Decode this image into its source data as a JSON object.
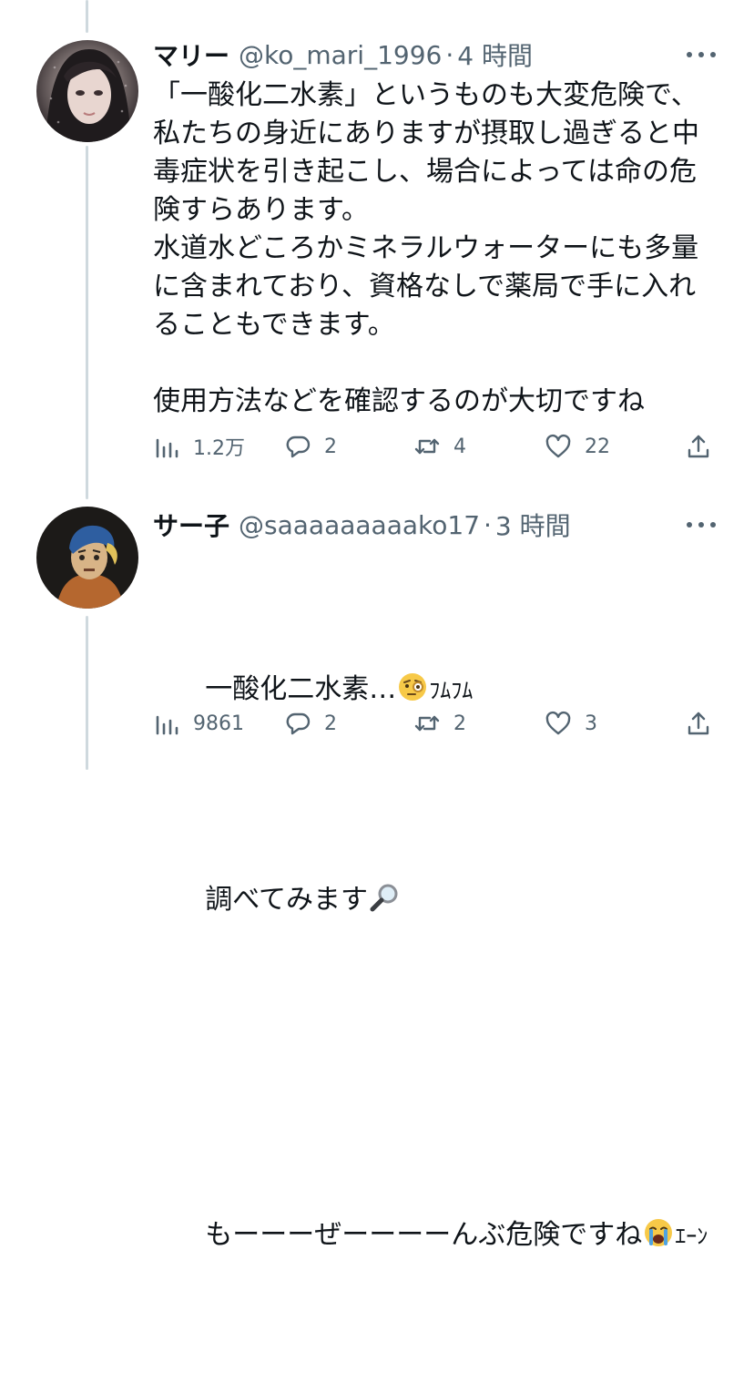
{
  "tweets": [
    {
      "display_name": "マリー",
      "handle": "@ko_mari_1996",
      "separator": "·",
      "time": "4 時間",
      "text": "「一酸化二水素」というものも大変危険で、\n私たちの身近にありますが摂取し過ぎると中\n毒症状を引き起こし、場合によっては命の危\n険すらあります。\n水道水どころかミネラルウォーターにも多量\nに含まれており、資格なしで薬局で手に入れ\nることもできます。\n\n使用方法などを確認するのが大切ですね",
      "views": "1.2万",
      "replies": "2",
      "retweets": "4",
      "likes": "22"
    },
    {
      "display_name": "サー子",
      "handle": "@saaaaaaaaako17",
      "separator": "·",
      "time": "3 時間",
      "line1": "一酸化二水素…",
      "line1_suffix": "ﾌﾑﾌﾑ",
      "line2": "調べてみます",
      "line3": "もーーーぜーーーーんぶ危険ですね",
      "line3_suffix": "ｴｰﾝ",
      "views": "9861",
      "replies": "2",
      "retweets": "2",
      "likes": "3"
    }
  ],
  "icons": {
    "views": "bar-chart-icon",
    "reply": "speech-bubble-icon",
    "retweet": "retweet-icon",
    "like": "heart-icon",
    "share": "share-icon",
    "more": "more-dots-icon",
    "emoji1": "face-with-monocle-emoji",
    "emoji2": "magnifying-glass-emoji",
    "emoji3": "loudly-crying-face-emoji"
  },
  "colors": {
    "text": "#0f1419",
    "secondary": "#536471",
    "thread_line": "#cfd9de"
  }
}
